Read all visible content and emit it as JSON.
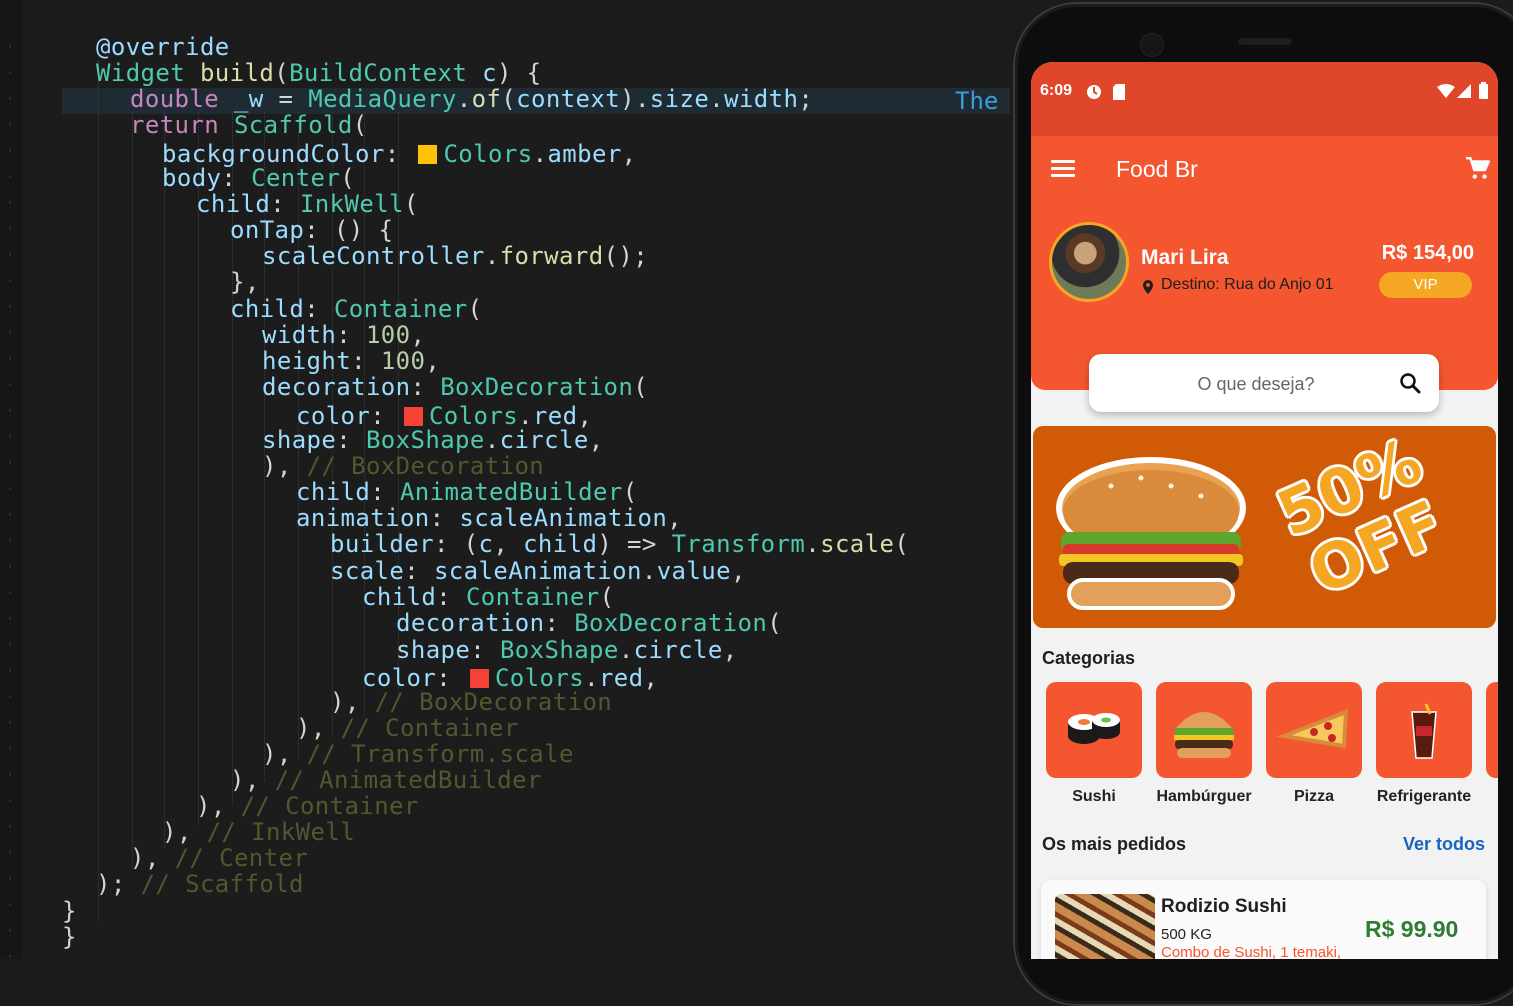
{
  "editor": {
    "lines": [
      [
        [
          "@override",
          "t-an"
        ]
      ],
      [
        [
          "Widget ",
          "t-ty"
        ],
        [
          "build",
          "t-fn"
        ],
        [
          "(",
          "t-pu"
        ],
        [
          "BuildContext ",
          "t-ty"
        ],
        [
          "c",
          "t-pr"
        ],
        [
          ") {",
          "t-pu"
        ]
      ],
      [
        [
          "double ",
          "t-kw"
        ],
        [
          "_w",
          "t-pr"
        ],
        [
          " = ",
          "t-pu"
        ],
        [
          "MediaQuery",
          "t-ty"
        ],
        [
          ".",
          "t-pu"
        ],
        [
          "of",
          "t-fn"
        ],
        [
          "(",
          "t-pu"
        ],
        [
          "context",
          "t-pr"
        ],
        [
          ").",
          "t-pu"
        ],
        [
          "size",
          "t-pr"
        ],
        [
          ".",
          "t-pu"
        ],
        [
          "width",
          "t-pr"
        ],
        [
          ";",
          "t-pu"
        ]
      ],
      [
        [
          "return ",
          "t-kw"
        ],
        [
          "Scaffold",
          "t-ty"
        ],
        [
          "(",
          "t-pu"
        ]
      ],
      [
        [
          "backgroundColor",
          "t-pr"
        ],
        [
          ": ",
          "t-pu"
        ],
        [
          "■",
          "swatch-amber"
        ],
        [
          "Colors",
          "t-ty"
        ],
        [
          ".",
          "t-pu"
        ],
        [
          "amber",
          "t-pr"
        ],
        [
          ",",
          "t-pu"
        ]
      ],
      [
        [
          "body",
          "t-pr"
        ],
        [
          ": ",
          "t-pu"
        ],
        [
          "Center",
          "t-ty"
        ],
        [
          "(",
          "t-pu"
        ]
      ],
      [
        [
          "child",
          "t-pr"
        ],
        [
          ": ",
          "t-pu"
        ],
        [
          "InkWell",
          "t-ty"
        ],
        [
          "(",
          "t-pu"
        ]
      ],
      [
        [
          "onTap",
          "t-pr"
        ],
        [
          ": () {",
          "t-pu"
        ]
      ],
      [
        [
          "scaleController",
          "t-pr"
        ],
        [
          ".",
          "t-pu"
        ],
        [
          "forward",
          "t-fn"
        ],
        [
          "();",
          "t-pu"
        ]
      ],
      [
        [
          "},",
          "t-pu"
        ]
      ],
      [
        [
          "child",
          "t-pr"
        ],
        [
          ": ",
          "t-pu"
        ],
        [
          "Container",
          "t-ty"
        ],
        [
          "(",
          "t-pu"
        ]
      ],
      [
        [
          "width",
          "t-pr"
        ],
        [
          ": ",
          "t-pu"
        ],
        [
          "100",
          "t-nm"
        ],
        [
          ",",
          "t-pu"
        ]
      ],
      [
        [
          "height",
          "t-pr"
        ],
        [
          ": ",
          "t-pu"
        ],
        [
          "100",
          "t-nm"
        ],
        [
          ",",
          "t-pu"
        ]
      ],
      [
        [
          "decoration",
          "t-pr"
        ],
        [
          ": ",
          "t-pu"
        ],
        [
          "BoxDecoration",
          "t-ty"
        ],
        [
          "(",
          "t-pu"
        ]
      ],
      [
        [
          "color",
          "t-pr"
        ],
        [
          ": ",
          "t-pu"
        ],
        [
          "■",
          "swatch-red"
        ],
        [
          "Colors",
          "t-ty"
        ],
        [
          ".",
          "t-pu"
        ],
        [
          "red",
          "t-pr"
        ],
        [
          ",",
          "t-pu"
        ]
      ],
      [
        [
          "shape",
          "t-pr"
        ],
        [
          ": ",
          "t-pu"
        ],
        [
          "BoxShape",
          "t-ty"
        ],
        [
          ".",
          "t-pu"
        ],
        [
          "circle",
          "t-pr"
        ],
        [
          ",",
          "t-pu"
        ]
      ],
      [
        [
          "), ",
          "t-pu"
        ],
        [
          "// BoxDecoration",
          "t-cm"
        ]
      ],
      [
        [
          "child",
          "t-pr"
        ],
        [
          ": ",
          "t-pu"
        ],
        [
          "AnimatedBuilder",
          "t-ty"
        ],
        [
          "(",
          "t-pu"
        ]
      ],
      [
        [
          "animation",
          "t-pr"
        ],
        [
          ": ",
          "t-pu"
        ],
        [
          "scaleAnimation",
          "t-pr"
        ],
        [
          ",",
          "t-pu"
        ]
      ],
      [
        [
          "builder",
          "t-pr"
        ],
        [
          ": (",
          "t-pu"
        ],
        [
          "c",
          "t-pr"
        ],
        [
          ", ",
          "t-pu"
        ],
        [
          "child",
          "t-pr"
        ],
        [
          ") => ",
          "t-pu"
        ],
        [
          "Transform",
          "t-ty"
        ],
        [
          ".",
          "t-pu"
        ],
        [
          "scale",
          "t-fn"
        ],
        [
          "(",
          "t-pu"
        ]
      ],
      [
        [
          "scale",
          "t-pr"
        ],
        [
          ": ",
          "t-pu"
        ],
        [
          "scaleAnimation",
          "t-pr"
        ],
        [
          ".",
          "t-pu"
        ],
        [
          "value",
          "t-pr"
        ],
        [
          ",",
          "t-pu"
        ]
      ],
      [
        [
          "child",
          "t-pr"
        ],
        [
          ": ",
          "t-pu"
        ],
        [
          "Container",
          "t-ty"
        ],
        [
          "(",
          "t-pu"
        ]
      ],
      [
        [
          "decoration",
          "t-pr"
        ],
        [
          ": ",
          "t-pu"
        ],
        [
          "BoxDecoration",
          "t-ty"
        ],
        [
          "(",
          "t-pu"
        ]
      ],
      [
        [
          "shape",
          "t-pr"
        ],
        [
          ": ",
          "t-pu"
        ],
        [
          "BoxShape",
          "t-ty"
        ],
        [
          ".",
          "t-pu"
        ],
        [
          "circle",
          "t-pr"
        ],
        [
          ",",
          "t-pu"
        ]
      ],
      [
        [
          "color",
          "t-pr"
        ],
        [
          ": ",
          "t-pu"
        ],
        [
          "■",
          "swatch-red"
        ],
        [
          "Colors",
          "t-ty"
        ],
        [
          ".",
          "t-pu"
        ],
        [
          "red",
          "t-pr"
        ],
        [
          ",",
          "t-pu"
        ]
      ],
      [
        [
          "), ",
          "t-pu"
        ],
        [
          "// BoxDecoration",
          "t-cm"
        ]
      ],
      [
        [
          "), ",
          "t-pu"
        ],
        [
          "// Container",
          "t-cm"
        ]
      ],
      [
        [
          "), ",
          "t-pu"
        ],
        [
          "// Transform.scale",
          "t-cm"
        ]
      ],
      [
        [
          "), ",
          "t-pu"
        ],
        [
          "// AnimatedBuilder",
          "t-cm"
        ]
      ],
      [
        [
          "), ",
          "t-pu"
        ],
        [
          "// Container",
          "t-cm"
        ]
      ],
      [
        [
          "), ",
          "t-pu"
        ],
        [
          "// InkWell",
          "t-cm"
        ]
      ],
      [
        [
          "), ",
          "t-pu"
        ],
        [
          "// Center",
          "t-cm"
        ]
      ],
      [
        [
          "); ",
          "t-pu"
        ],
        [
          "// Scaffold",
          "t-cm"
        ]
      ],
      [
        [
          "}",
          "t-pu"
        ]
      ],
      [
        [
          "}",
          "t-pu"
        ]
      ]
    ],
    "hint_text": "The",
    "colors": {
      "amber": "#ffc107",
      "red": "#f44336"
    }
  },
  "phone": {
    "status": {
      "time": "6:09"
    },
    "app_title": "Food Br",
    "user": {
      "name": "Mari Lira",
      "destination": "Destino: Rua do Anjo 01",
      "balance": "R$ 154,00",
      "badge": "VIP"
    },
    "search": {
      "placeholder": "O que deseja?"
    },
    "banner": {
      "text": "50% OFF"
    },
    "categories_title": "Categorias",
    "categories": [
      {
        "label": "Sushi",
        "icon": "sushi-icon"
      },
      {
        "label": "Hambúrguer",
        "icon": "burger-icon"
      },
      {
        "label": "Pizza",
        "icon": "pizza-icon"
      },
      {
        "label": "Refrigerante",
        "icon": "soda-icon"
      }
    ],
    "popular_title": "Os mais pedidos",
    "see_all": "Ver todos",
    "order": {
      "name": "Rodizio Sushi",
      "weight": "500 KG",
      "description": "Combo de Sushi, 1 temaki,",
      "price": "R$ 99.90"
    },
    "colors": {
      "primary": "#f4572f",
      "accent": "#f5a623",
      "price_green": "#2e7d32",
      "link_blue": "#1565c0"
    }
  }
}
